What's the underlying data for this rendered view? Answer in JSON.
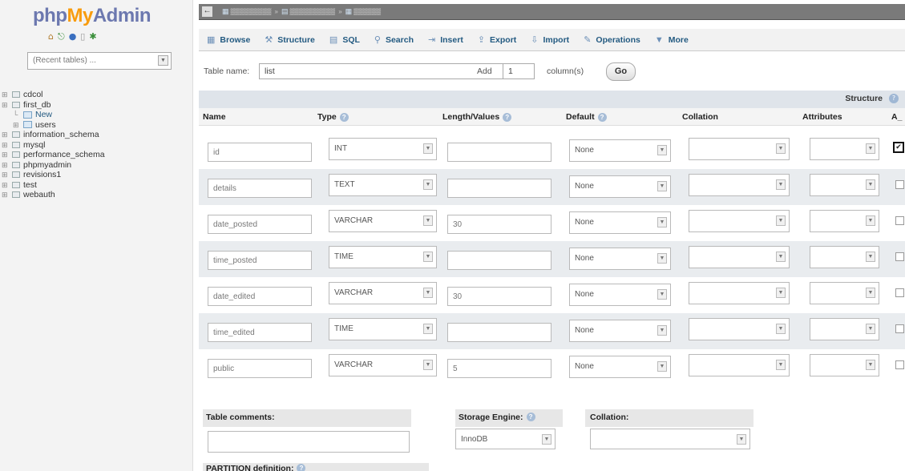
{
  "logo": {
    "php": "php",
    "my": "My",
    "admin": "Admin"
  },
  "recent_tables": {
    "value": "(Recent tables) ..."
  },
  "databases": [
    {
      "name": "cdcol",
      "level": 0,
      "kind": "db"
    },
    {
      "name": "first_db",
      "level": 0,
      "kind": "db"
    },
    {
      "name": "New",
      "level": 1,
      "kind": "new"
    },
    {
      "name": "users",
      "level": 1,
      "kind": "table"
    },
    {
      "name": "information_schema",
      "level": 0,
      "kind": "db"
    },
    {
      "name": "mysql",
      "level": 0,
      "kind": "db"
    },
    {
      "name": "performance_schema",
      "level": 0,
      "kind": "db"
    },
    {
      "name": "phpmyadmin",
      "level": 0,
      "kind": "db"
    },
    {
      "name": "revisions1",
      "level": 0,
      "kind": "db"
    },
    {
      "name": "test",
      "level": 0,
      "kind": "db"
    },
    {
      "name": "webauth",
      "level": 0,
      "kind": "db"
    }
  ],
  "tabs": [
    {
      "label": "Browse",
      "icon": "browse-icon"
    },
    {
      "label": "Structure",
      "icon": "structure-icon"
    },
    {
      "label": "SQL",
      "icon": "sql-icon"
    },
    {
      "label": "Search",
      "icon": "search-icon"
    },
    {
      "label": "Insert",
      "icon": "insert-icon"
    },
    {
      "label": "Export",
      "icon": "export-icon"
    },
    {
      "label": "Import",
      "icon": "import-icon"
    },
    {
      "label": "Operations",
      "icon": "wrench-icon"
    },
    {
      "label": "More",
      "icon": "chevron-down-icon"
    }
  ],
  "table_name": {
    "label": "Table name:",
    "value": "list"
  },
  "add_columns": {
    "label": "Add",
    "value": "1",
    "suffix": "column(s)",
    "button": "Go"
  },
  "structure": {
    "title": "Structure",
    "headers": [
      "Name",
      "Type",
      "Length/Values",
      "Default",
      "Collation",
      "Attributes",
      "A_"
    ],
    "rows": [
      {
        "name": "id",
        "type": "INT",
        "length": "",
        "default": "None",
        "ai": true
      },
      {
        "name": "details",
        "type": "TEXT",
        "length": "",
        "default": "None",
        "ai": false
      },
      {
        "name": "date_posted",
        "type": "VARCHAR",
        "length": "30",
        "default": "None",
        "ai": false
      },
      {
        "name": "time_posted",
        "type": "TIME",
        "length": "",
        "default": "None",
        "ai": false
      },
      {
        "name": "date_edited",
        "type": "VARCHAR",
        "length": "30",
        "default": "None",
        "ai": false
      },
      {
        "name": "time_edited",
        "type": "TIME",
        "length": "",
        "default": "None",
        "ai": false
      },
      {
        "name": "public",
        "type": "VARCHAR",
        "length": "5",
        "default": "None",
        "ai": false
      }
    ]
  },
  "table_comments": {
    "label": "Table comments:"
  },
  "storage_engine": {
    "label": "Storage Engine:",
    "value": "InnoDB"
  },
  "collation": {
    "label": "Collation:"
  },
  "partition": {
    "label": "PARTITION definition:"
  }
}
